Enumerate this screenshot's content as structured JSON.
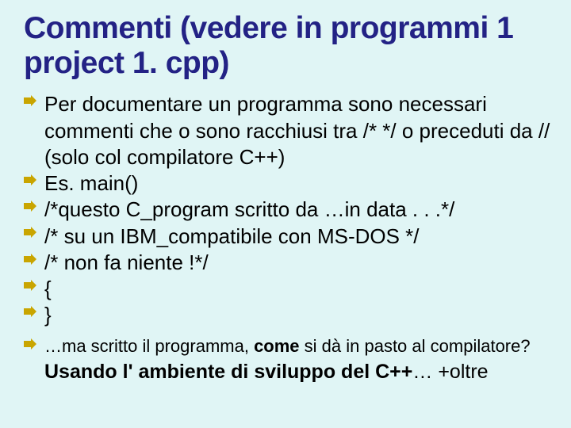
{
  "title": "Commenti (vedere in programmi 1 project 1. cpp)",
  "bullets": [
    "Per documentare un programma sono necessari commenti che o sono racchiusi tra /* */ o preceduti da // (solo col compilatore C++)",
    "Es. main()",
    "   /*questo C_program scritto da …in data . . .*/",
    "   /* su un IBM_compatibile con MS-DOS */",
    "   /* non fa niente !*/",
    "  {",
    "   }"
  ],
  "footnote_prefix": "…ma scritto il programma, ",
  "footnote_bold": "come",
  "footnote_suffix": " si dà in pasto al compilatore?",
  "closing_bold": "Usando l' ambiente di sviluppo del C++",
  "closing_rest": "… +oltre"
}
